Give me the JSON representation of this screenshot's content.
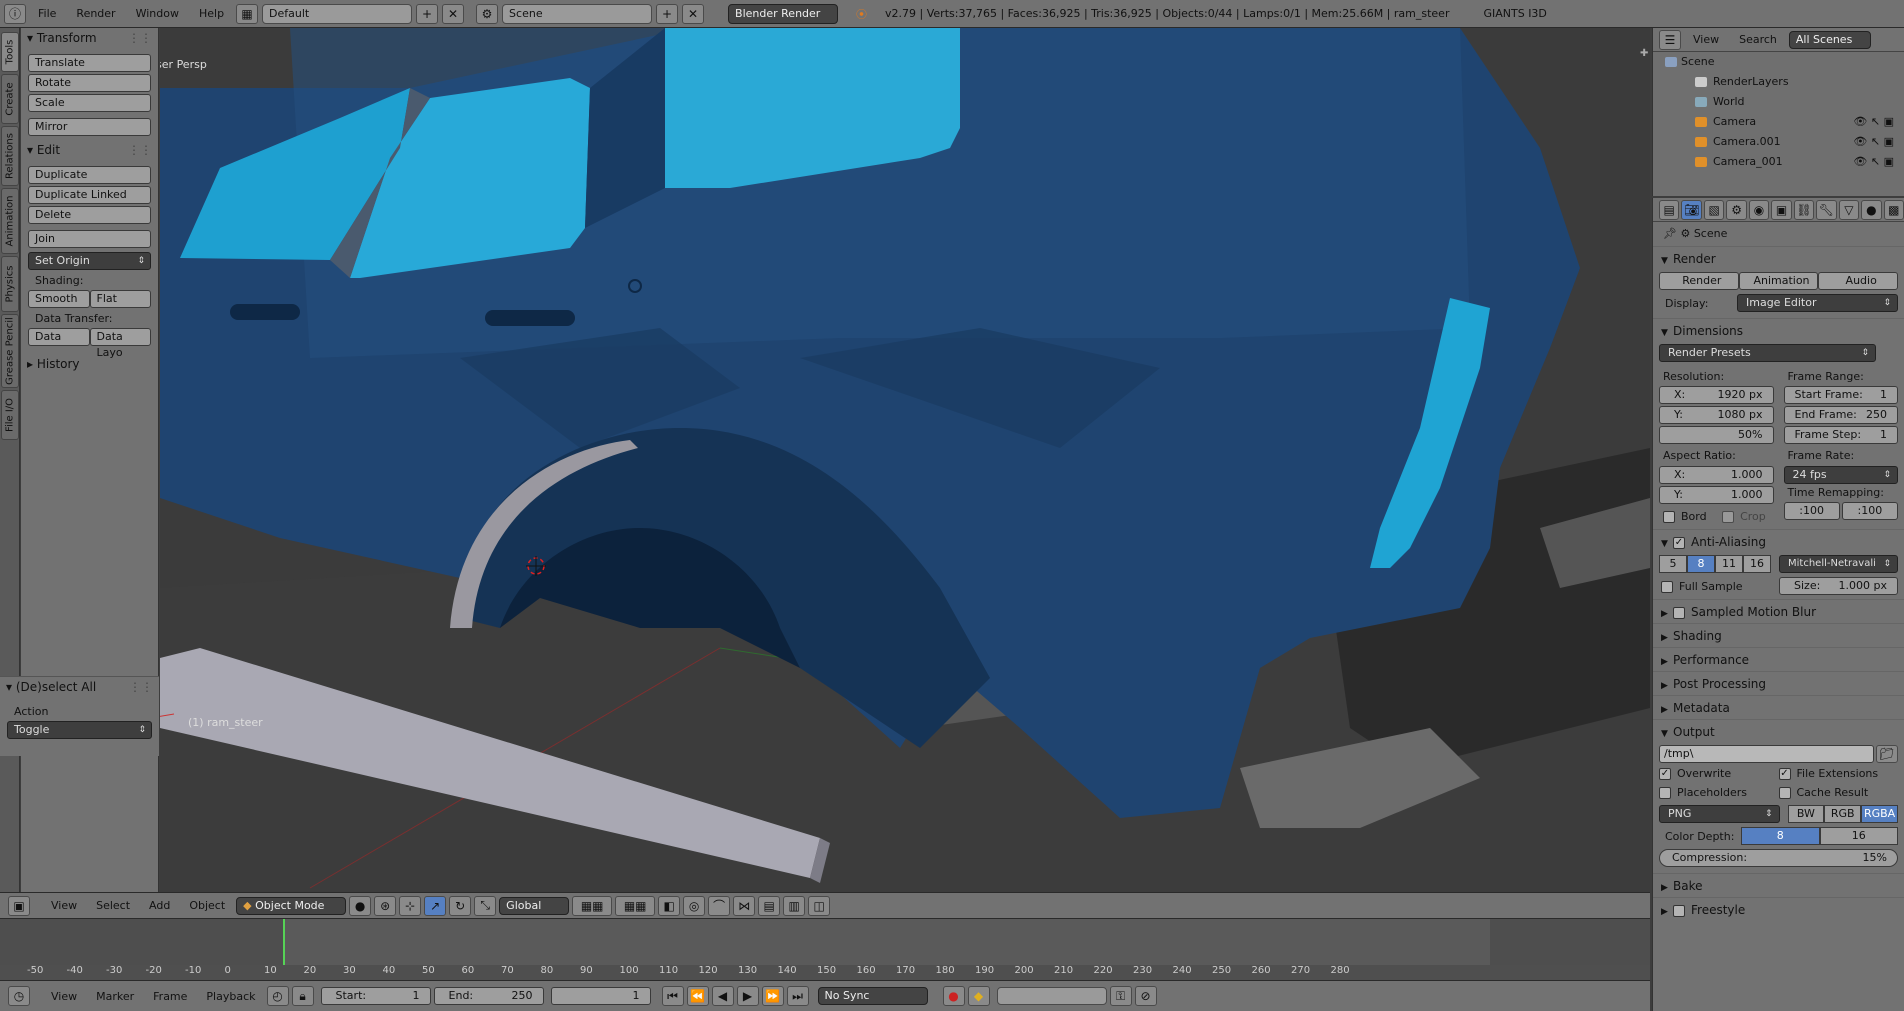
{
  "topbar": {
    "menus": [
      "File",
      "Render",
      "Window",
      "Help"
    ],
    "layout": "Default",
    "scene": "Scene",
    "engine": "Blender Render",
    "stats": "v2.79 | Verts:37,765 | Faces:36,925 | Tris:36,925 | Objects:0/44 | Lamps:0/1 | Mem:25.66M | ram_steer",
    "addon": "GIANTS I3D"
  },
  "tabs": [
    "Tools",
    "Create",
    "Relations",
    "Animation",
    "Physics",
    "Grease Pencil",
    "File I/O"
  ],
  "toolshelf": {
    "transform": {
      "title": "Transform",
      "buttons": [
        "Translate",
        "Rotate",
        "Scale",
        "Mirror"
      ]
    },
    "edit": {
      "title": "Edit",
      "buttons": [
        "Duplicate",
        "Duplicate Linked",
        "Delete",
        "Join"
      ],
      "set_origin": "Set Origin",
      "shading_label": "Shading:",
      "smooth": "Smooth",
      "flat": "Flat",
      "data_transfer_label": "Data Transfer:",
      "data": "Data",
      "data_layout": "Data Layo"
    },
    "history": "History",
    "operator": {
      "title": "(De)select All",
      "action_label": "Action",
      "action_value": "Toggle"
    }
  },
  "viewport": {
    "view_label": "User Persp",
    "object_label": "(1) ram_steer"
  },
  "view_header": {
    "menus": [
      "View",
      "Select",
      "Add",
      "Object"
    ],
    "mode": "Object Mode",
    "orientation": "Global"
  },
  "timeline": {
    "ticks": [
      "-50",
      "-40",
      "-30",
      "-20",
      "-10",
      "0",
      "10",
      "20",
      "30",
      "40",
      "50",
      "60",
      "70",
      "80",
      "90",
      "100",
      "110",
      "120",
      "130",
      "140",
      "150",
      "160",
      "170",
      "180",
      "190",
      "200",
      "210",
      "220",
      "230",
      "240",
      "250",
      "260",
      "270",
      "280"
    ],
    "menus": [
      "View",
      "Marker",
      "Frame",
      "Playback"
    ],
    "start_label": "Start:",
    "start_value": "1",
    "end_label": "End:",
    "end_value": "250",
    "current": "1",
    "sync": "No Sync"
  },
  "outliner": {
    "menus": [
      "View",
      "Search"
    ],
    "filter": "All Scenes",
    "items": [
      "Scene",
      "RenderLayers",
      "World",
      "Camera",
      "Camera.001",
      "Camera_001"
    ]
  },
  "properties": {
    "context": "Scene",
    "render": {
      "title": "Render",
      "buttons": [
        "Render",
        "Animation",
        "Audio"
      ],
      "display_label": "Display:",
      "display_value": "Image Editor"
    },
    "dimensions": {
      "title": "Dimensions",
      "presets": "Render Presets",
      "resolution_label": "Resolution:",
      "res_x": "1920 px",
      "res_y": "1080 px",
      "res_pct": "50%",
      "frame_range_label": "Frame Range:",
      "start_frame": "1",
      "end_frame": "250",
      "frame_step": "1",
      "aspect_label": "Aspect Ratio:",
      "aspect_x": "1.000",
      "aspect_y": "1.000",
      "frame_rate_label": "Frame Rate:",
      "frame_rate": "24 fps",
      "remap_label": "Time Remapping:",
      "remap_old": ":100",
      "remap_new": ":100",
      "bord": "Bord",
      "crop": "Crop"
    },
    "antialiasing": {
      "title": "Anti-Aliasing",
      "samples": [
        "5",
        "8",
        "11",
        "16"
      ],
      "selected": "8",
      "filter": "Mitchell-Netravali",
      "full_sample": "Full Sample",
      "size_label": "Size:",
      "size_value": "1.000 px"
    },
    "collapsed": [
      "Sampled Motion Blur",
      "Shading",
      "Performance",
      "Post Processing",
      "Metadata"
    ],
    "output": {
      "title": "Output",
      "path": "/tmp\\",
      "overwrite": "Overwrite",
      "file_extensions": "File Extensions",
      "placeholders": "Placeholders",
      "cache_result": "Cache Result",
      "format": "PNG",
      "color_modes": [
        "BW",
        "RGB",
        "RGBA"
      ],
      "color_mode_selected": "RGBA",
      "depth_label": "Color Depth:",
      "depths": [
        "8",
        "16"
      ],
      "compression_label": "Compression:",
      "compression_value": "15%"
    },
    "bottom": [
      "Bake",
      "Freestyle"
    ]
  },
  "colors": {
    "car_body": "#1d4470",
    "glass": "#2aa9d6",
    "ui_bg": "#727272",
    "active_blue": "#5680c2"
  }
}
